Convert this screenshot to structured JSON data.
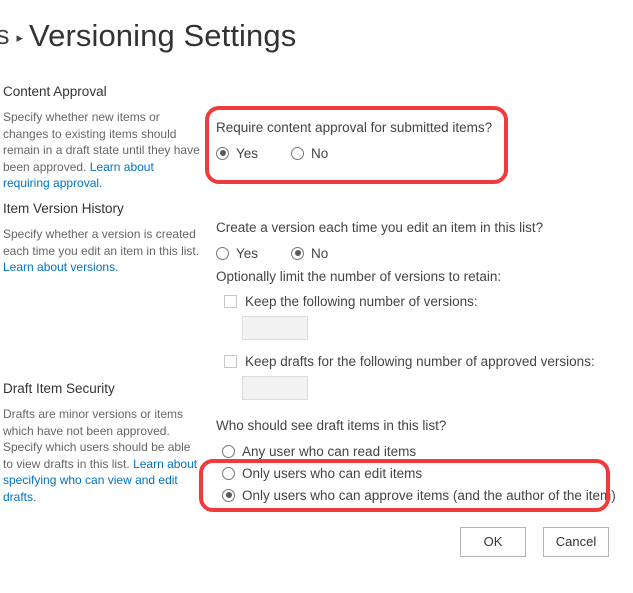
{
  "header": {
    "breadcrumb_tail": "s",
    "breadcrumb_separator": "▸",
    "title": "Versioning Settings"
  },
  "sections": [
    {
      "heading": "Content Approval",
      "description_part1": "Specify whether new items or changes to existing items should remain in a draft state until they have been approved.",
      "link_text": "Learn about requiring approval.",
      "question": "Require content approval for submitted items?",
      "options": [
        {
          "label": "Yes",
          "selected": true
        },
        {
          "label": "No",
          "selected": false
        }
      ]
    },
    {
      "heading": "Item Version History",
      "description_part1": "Specify whether a version is created each time you edit an item in this list.",
      "link_text": "Learn about versions.",
      "question": "Create a version each time you edit an item in this list?",
      "options": [
        {
          "label": "Yes",
          "selected": false
        },
        {
          "label": "No",
          "selected": true
        }
      ],
      "sub_label": "Optionally limit the number of versions to retain:",
      "checkboxes": [
        {
          "label": "Keep the following number of versions:",
          "checked": false,
          "value": "",
          "disabled": true
        },
        {
          "label": "Keep drafts for the following number of approved versions:",
          "checked": false,
          "value": "",
          "disabled": true
        }
      ]
    },
    {
      "heading": "Draft Item Security",
      "description_part1": "Drafts are minor versions or items which have not been approved. Specify which users should be able to view drafts in this list.",
      "link_text": "Learn about specifying who can view and edit drafts.",
      "question": "Who should see draft items in this list?",
      "options": [
        {
          "label": "Any user who can read items",
          "selected": false
        },
        {
          "label": "Only users who can edit items",
          "selected": false
        },
        {
          "label": "Only users who can approve items (and the author of the item)",
          "selected": true
        }
      ]
    }
  ],
  "annotations": {
    "highlight_color": "#ef3b3b",
    "boxes": [
      {
        "name": "content-approval-highlight"
      },
      {
        "name": "draft-security-highlight"
      }
    ]
  },
  "buttons": {
    "ok_label": "OK",
    "cancel_label": "Cancel"
  }
}
